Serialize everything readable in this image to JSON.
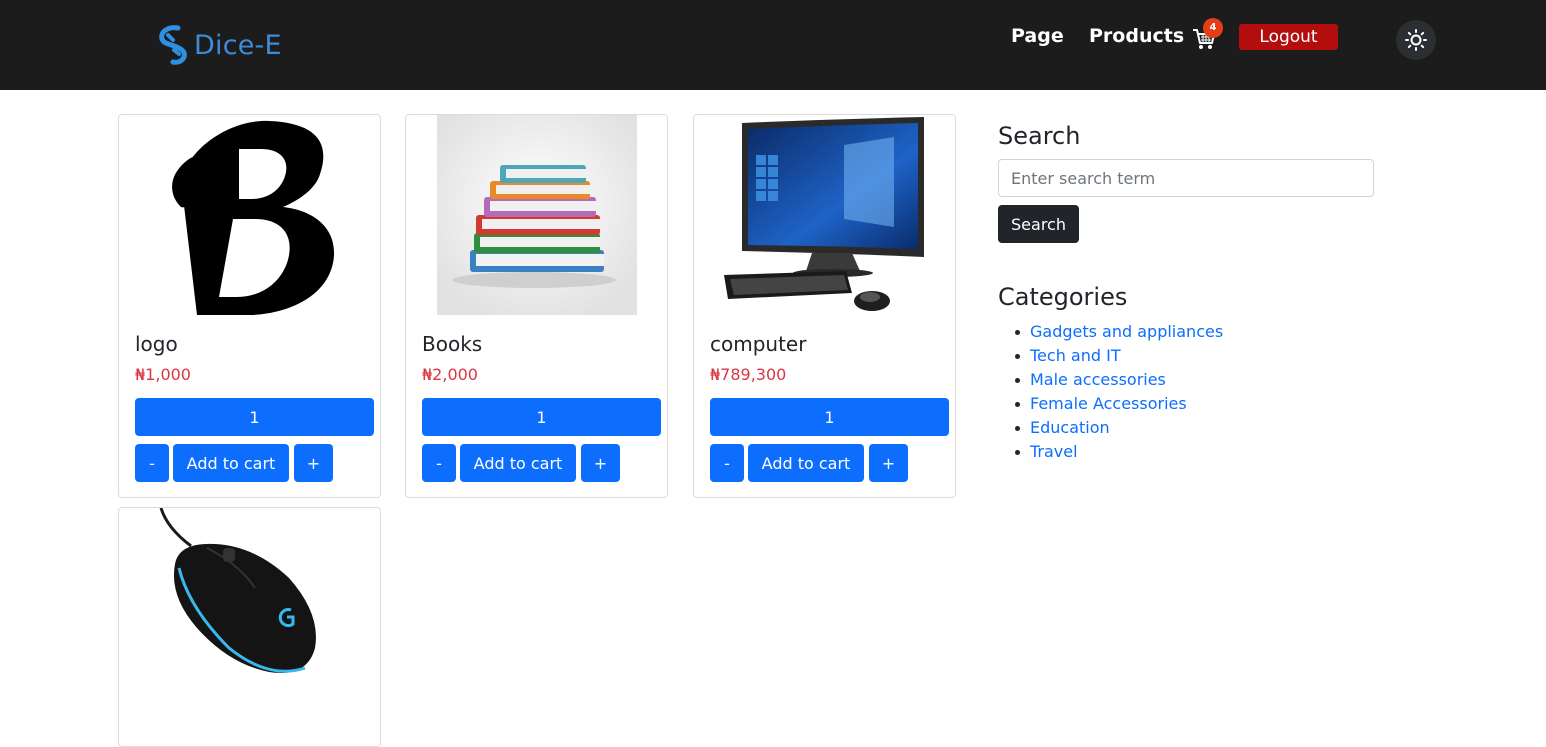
{
  "brand": {
    "name": "Dice-E"
  },
  "nav": {
    "page_label": "Page",
    "products_label": "Products",
    "cart_count": "4",
    "logout_label": "Logout"
  },
  "products": [
    {
      "title": "logo",
      "price": "₦1,000",
      "qty": "1",
      "minus": "-",
      "add": "Add to cart",
      "plus": "+"
    },
    {
      "title": "Books",
      "price": "₦2,000",
      "qty": "1",
      "minus": "-",
      "add": "Add to cart",
      "plus": "+"
    },
    {
      "title": "computer",
      "price": "₦789,300",
      "qty": "1",
      "minus": "-",
      "add": "Add to cart",
      "plus": "+"
    }
  ],
  "sidebar": {
    "search_title": "Search",
    "search_placeholder": "Enter search term",
    "search_button": "Search",
    "categories_title": "Categories",
    "categories": [
      "Gadgets and appliances",
      "Tech and IT",
      "Male accessories",
      "Female Accessories",
      "Education",
      "Travel"
    ]
  },
  "colors": {
    "navbar_bg": "#1c1c1c",
    "brand": "#3d8bd9",
    "primary": "#0d6efd",
    "price": "#dc3545",
    "logout": "#b30d0d",
    "badge": "#e53d16"
  },
  "icons": {
    "brand": "brand-s-icon",
    "cart": "cart-icon",
    "theme": "sun-icon"
  }
}
